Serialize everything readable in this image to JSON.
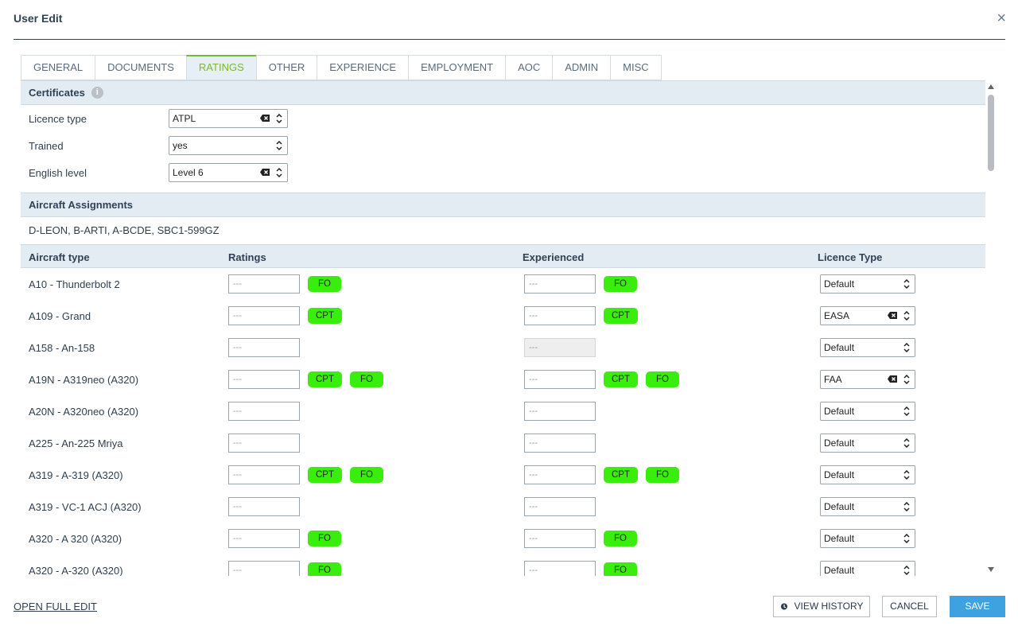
{
  "dialog": {
    "title": "User Edit",
    "close_glyph": "×"
  },
  "tabs": [
    "GENERAL",
    "DOCUMENTS",
    "RATINGS",
    "OTHER",
    "EXPERIENCE",
    "EMPLOYMENT",
    "AOC",
    "ADMIN",
    "MISC"
  ],
  "active_tab": "RATINGS",
  "certificates": {
    "heading": "Certificates",
    "info_glyph": "i",
    "licence_type": {
      "label": "Licence type",
      "value": "ATPL"
    },
    "trained": {
      "label": "Trained",
      "value": "yes"
    },
    "english_level": {
      "label": "English level",
      "value": "Level 6"
    }
  },
  "assignments": {
    "heading": "Aircraft Assignments",
    "text": "D-LEON, B-ARTI, A-BCDE, SBC1-599GZ"
  },
  "table": {
    "headers": {
      "aircraft": "Aircraft type",
      "ratings": "Ratings",
      "experienced": "Experienced",
      "licence": "Licence Type"
    },
    "placeholder": "---",
    "rows": [
      {
        "aircraft": "A10 - Thunderbolt 2",
        "ratings": [
          "FO"
        ],
        "experienced": [
          "FO"
        ],
        "licence": "Default"
      },
      {
        "aircraft": "A109 - Grand",
        "ratings": [
          "CPT"
        ],
        "experienced": [
          "CPT"
        ],
        "licence": "EASA"
      },
      {
        "aircraft": "A158 - An-158",
        "ratings": [],
        "experienced": [],
        "licence": "Default",
        "exp_disabled": true
      },
      {
        "aircraft": "A19N - A319neo (A320)",
        "ratings": [
          "CPT",
          "FO"
        ],
        "experienced": [
          "CPT",
          "FO"
        ],
        "licence": "FAA"
      },
      {
        "aircraft": "A20N - A320neo (A320)",
        "ratings": [],
        "experienced": [],
        "licence": "Default"
      },
      {
        "aircraft": "A225 - An-225 Mriya",
        "ratings": [],
        "experienced": [],
        "licence": "Default"
      },
      {
        "aircraft": "A319 - A-319 (A320)",
        "ratings": [
          "CPT",
          "FO"
        ],
        "experienced": [
          "CPT",
          "FO"
        ],
        "licence": "Default"
      },
      {
        "aircraft": "A319 - VC-1 ACJ (A320)",
        "ratings": [],
        "experienced": [],
        "licence": "Default"
      },
      {
        "aircraft": "A320 - A 320 (A320)",
        "ratings": [
          "FO"
        ],
        "experienced": [
          "FO"
        ],
        "licence": "Default"
      },
      {
        "aircraft": "A320 - A-320 (A320)",
        "ratings": [
          "FO"
        ],
        "experienced": [
          "FO"
        ],
        "licence": "Default"
      }
    ]
  },
  "footer": {
    "open_full_edit": "OPEN FULL EDIT",
    "view_history": "VIEW HISTORY",
    "cancel": "CANCEL",
    "save": "SAVE"
  },
  "colors": {
    "accent_green": "#7cb82f",
    "tag_green": "#39ee0c",
    "save_blue": "#3fa2e0"
  },
  "icons": [
    "close-icon",
    "info-icon",
    "clear-icon",
    "updown-icon",
    "history-icon"
  ]
}
